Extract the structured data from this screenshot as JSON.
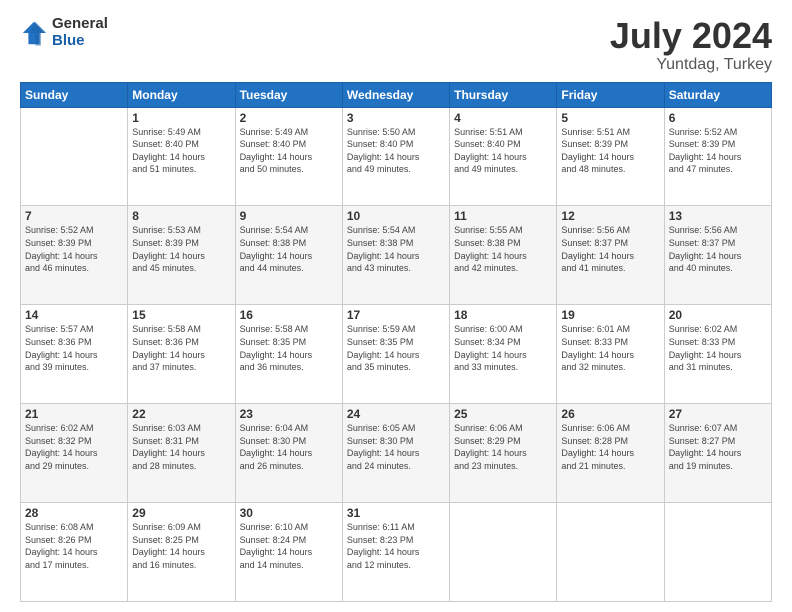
{
  "logo": {
    "general": "General",
    "blue": "Blue"
  },
  "title": "July 2024",
  "subtitle": "Yuntdag, Turkey",
  "headers": [
    "Sunday",
    "Monday",
    "Tuesday",
    "Wednesday",
    "Thursday",
    "Friday",
    "Saturday"
  ],
  "weeks": [
    [
      {
        "day": "",
        "info": ""
      },
      {
        "day": "1",
        "info": "Sunrise: 5:49 AM\nSunset: 8:40 PM\nDaylight: 14 hours\nand 51 minutes."
      },
      {
        "day": "2",
        "info": "Sunrise: 5:49 AM\nSunset: 8:40 PM\nDaylight: 14 hours\nand 50 minutes."
      },
      {
        "day": "3",
        "info": "Sunrise: 5:50 AM\nSunset: 8:40 PM\nDaylight: 14 hours\nand 49 minutes."
      },
      {
        "day": "4",
        "info": "Sunrise: 5:51 AM\nSunset: 8:40 PM\nDaylight: 14 hours\nand 49 minutes."
      },
      {
        "day": "5",
        "info": "Sunrise: 5:51 AM\nSunset: 8:39 PM\nDaylight: 14 hours\nand 48 minutes."
      },
      {
        "day": "6",
        "info": "Sunrise: 5:52 AM\nSunset: 8:39 PM\nDaylight: 14 hours\nand 47 minutes."
      }
    ],
    [
      {
        "day": "7",
        "info": "Sunrise: 5:52 AM\nSunset: 8:39 PM\nDaylight: 14 hours\nand 46 minutes."
      },
      {
        "day": "8",
        "info": "Sunrise: 5:53 AM\nSunset: 8:39 PM\nDaylight: 14 hours\nand 45 minutes."
      },
      {
        "day": "9",
        "info": "Sunrise: 5:54 AM\nSunset: 8:38 PM\nDaylight: 14 hours\nand 44 minutes."
      },
      {
        "day": "10",
        "info": "Sunrise: 5:54 AM\nSunset: 8:38 PM\nDaylight: 14 hours\nand 43 minutes."
      },
      {
        "day": "11",
        "info": "Sunrise: 5:55 AM\nSunset: 8:38 PM\nDaylight: 14 hours\nand 42 minutes."
      },
      {
        "day": "12",
        "info": "Sunrise: 5:56 AM\nSunset: 8:37 PM\nDaylight: 14 hours\nand 41 minutes."
      },
      {
        "day": "13",
        "info": "Sunrise: 5:56 AM\nSunset: 8:37 PM\nDaylight: 14 hours\nand 40 minutes."
      }
    ],
    [
      {
        "day": "14",
        "info": "Sunrise: 5:57 AM\nSunset: 8:36 PM\nDaylight: 14 hours\nand 39 minutes."
      },
      {
        "day": "15",
        "info": "Sunrise: 5:58 AM\nSunset: 8:36 PM\nDaylight: 14 hours\nand 37 minutes."
      },
      {
        "day": "16",
        "info": "Sunrise: 5:58 AM\nSunset: 8:35 PM\nDaylight: 14 hours\nand 36 minutes."
      },
      {
        "day": "17",
        "info": "Sunrise: 5:59 AM\nSunset: 8:35 PM\nDaylight: 14 hours\nand 35 minutes."
      },
      {
        "day": "18",
        "info": "Sunrise: 6:00 AM\nSunset: 8:34 PM\nDaylight: 14 hours\nand 33 minutes."
      },
      {
        "day": "19",
        "info": "Sunrise: 6:01 AM\nSunset: 8:33 PM\nDaylight: 14 hours\nand 32 minutes."
      },
      {
        "day": "20",
        "info": "Sunrise: 6:02 AM\nSunset: 8:33 PM\nDaylight: 14 hours\nand 31 minutes."
      }
    ],
    [
      {
        "day": "21",
        "info": "Sunrise: 6:02 AM\nSunset: 8:32 PM\nDaylight: 14 hours\nand 29 minutes."
      },
      {
        "day": "22",
        "info": "Sunrise: 6:03 AM\nSunset: 8:31 PM\nDaylight: 14 hours\nand 28 minutes."
      },
      {
        "day": "23",
        "info": "Sunrise: 6:04 AM\nSunset: 8:30 PM\nDaylight: 14 hours\nand 26 minutes."
      },
      {
        "day": "24",
        "info": "Sunrise: 6:05 AM\nSunset: 8:30 PM\nDaylight: 14 hours\nand 24 minutes."
      },
      {
        "day": "25",
        "info": "Sunrise: 6:06 AM\nSunset: 8:29 PM\nDaylight: 14 hours\nand 23 minutes."
      },
      {
        "day": "26",
        "info": "Sunrise: 6:06 AM\nSunset: 8:28 PM\nDaylight: 14 hours\nand 21 minutes."
      },
      {
        "day": "27",
        "info": "Sunrise: 6:07 AM\nSunset: 8:27 PM\nDaylight: 14 hours\nand 19 minutes."
      }
    ],
    [
      {
        "day": "28",
        "info": "Sunrise: 6:08 AM\nSunset: 8:26 PM\nDaylight: 14 hours\nand 17 minutes."
      },
      {
        "day": "29",
        "info": "Sunrise: 6:09 AM\nSunset: 8:25 PM\nDaylight: 14 hours\nand 16 minutes."
      },
      {
        "day": "30",
        "info": "Sunrise: 6:10 AM\nSunset: 8:24 PM\nDaylight: 14 hours\nand 14 minutes."
      },
      {
        "day": "31",
        "info": "Sunrise: 6:11 AM\nSunset: 8:23 PM\nDaylight: 14 hours\nand 12 minutes."
      },
      {
        "day": "",
        "info": ""
      },
      {
        "day": "",
        "info": ""
      },
      {
        "day": "",
        "info": ""
      }
    ]
  ]
}
